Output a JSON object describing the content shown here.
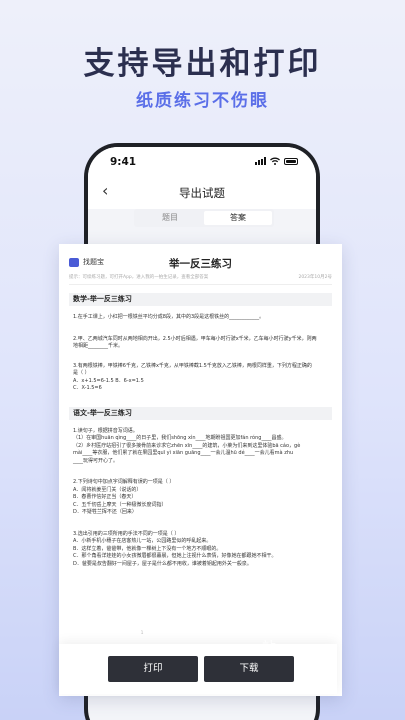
{
  "promo": {
    "headline": "支持导出和打印",
    "subline": "纸质练习不伤眼"
  },
  "phone": {
    "status_time": "9:41",
    "nav_title": "导出试题",
    "tabs": [
      "题目",
      "答案"
    ],
    "active_tab": "答案"
  },
  "document": {
    "logo_text": "找题宝",
    "logo_badge": "找题",
    "title": "举一反三练习",
    "meta_left": "提示：可续练习题，可打开App，进入我的一拍生记录，查看全部答案",
    "meta_right": "2023年10月2号",
    "sections": [
      {
        "title": "数学-举一反三练习",
        "questions": [
          [
            "1.在手工课上，小红把一根铁丝平均分成8段，其中的3段是这根铁丝的____________。"
          ],
          [
            "2.甲、乙两城汽车同时从两地相向开出，2.5小时后相遇，甲车每小时行驶x千米，乙车每小时行驶y千米，则两",
            "地相距________千米。"
          ],
          [
            "3.有两根铁棒，甲铁棒6千克，乙铁棒x千克，从甲铁棒截1.5千克放入乙铁棒，两根同样重，下列方程正确的",
            "是（    ）",
            "A．x+1.5=6-1.5  B．6-x=1.5",
            "C．X-1.5=6"
          ]
        ]
      },
      {
        "title": "语文-举一反三练习",
        "questions": [
          [
            "1.读句子，根据拼音写词语。",
            "（1）在审国huān qìng____的日子里，我们shōng xìn____地期盼祖国更加fán róng____昌盛。",
            "（2）乡村医疗站招引了很多接骨前来诊求它zhēn xīn____的建筑，小莱为们来到这里体验bā cáo，gè",
            "mài____等衣服，他们累了就在果园里quī yì xiān guāng____一会儿温hū dé____一会儿看mà zhu",
            "____玩得可开心了。"
          ],
          [
            "2.下列诗句中加点字词解释有误的一项是（  ）",
            "A．闻将就姜至门关（说话的）",
            "B．春曹作信好正当（春天）",
            "C．五千仞岳上摩天（一种极微长度词指）",
            "D．不疑牲兰挥不还（回来）"
          ],
          [
            "3.选出引用的三项所用的手法不同的一项是（  ）",
            "A．小新手机小穗子在店客热儿一站，公园路里似的呼乱起来。",
            "B．这样立着，爸爸带，他就像一棵树上下没有一个地方不顺眼的。",
            "C．那个角看洋娃娃的小女孩微眉都很暮晨，但她上注视什么表情，好像她在都跟她不相干。",
            "D．爸要是叔告翻好一间屋子，屋子是什么都不用收，谁被着钥起用外关一般泉。"
          ]
        ]
      }
    ],
    "page_indicator": "1"
  },
  "actions": {
    "print_label": "打印",
    "download_label": "下载"
  },
  "watermark": "站"
}
